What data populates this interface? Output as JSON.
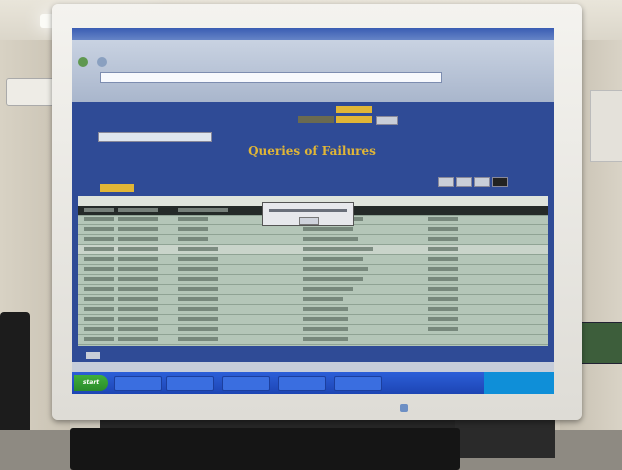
{
  "scene": {
    "description_kind": "photo of a monitor displaying a browser application"
  },
  "app": {
    "page_title": "Queries of Failures",
    "start_label": "start"
  },
  "colors": {
    "page_bg": "#2f4b96",
    "accent_yellow": "#e1b636",
    "taskbar": "#1d45b4",
    "table_bg": "#b4c6b8"
  }
}
